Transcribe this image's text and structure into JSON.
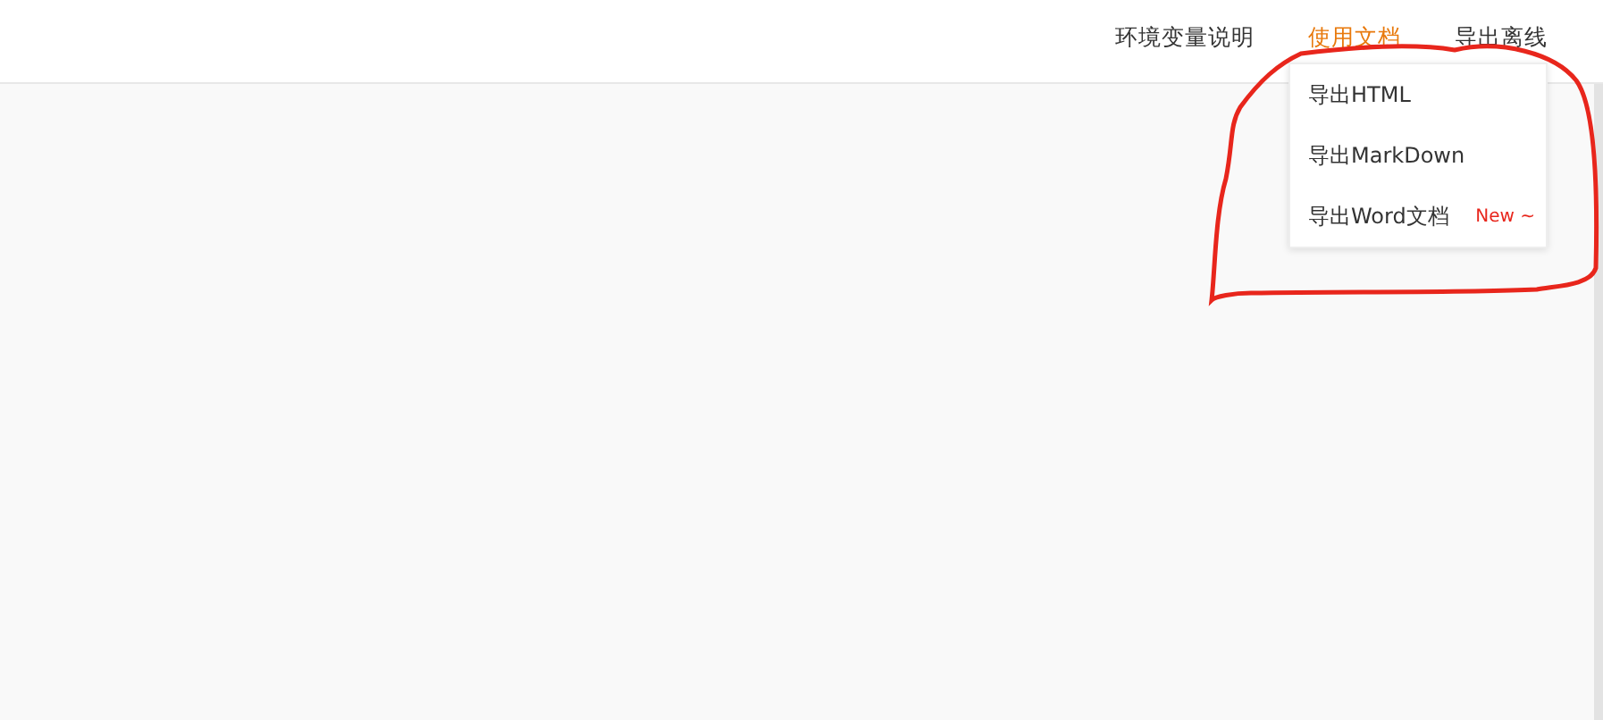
{
  "nav": [
    {
      "label": "环境变量说明",
      "selected": false
    },
    {
      "label": "使用文档",
      "selected": true
    },
    {
      "label": "导出离线",
      "selected": false
    }
  ],
  "export_menu": {
    "items": [
      {
        "label": "导出HTML"
      },
      {
        "label": "导出MarkDown"
      },
      {
        "label": "导出Word文档",
        "badge": "New ~"
      }
    ]
  }
}
